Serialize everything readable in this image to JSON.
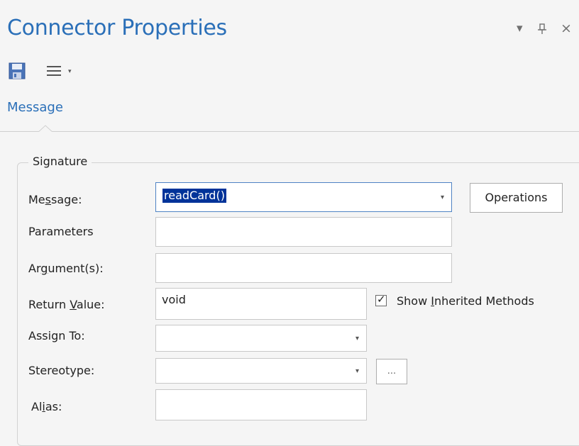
{
  "panel": {
    "title": "Connector Properties",
    "controls": {
      "dropdown_glyph": "▾",
      "pin_glyph": "ꟸ",
      "close_glyph": "×"
    }
  },
  "toolbar": {
    "save_icon": "save-icon",
    "menu_icon": "hamburger-menu-icon",
    "menu_caret": "▾"
  },
  "tab": {
    "label": "Message"
  },
  "signature": {
    "legend": "Signature",
    "message": {
      "label_pre": "Me",
      "label_u": "s",
      "label_post": "sage:",
      "value": "readCard()"
    },
    "operations_button": "Operations",
    "parameters": {
      "label": "Parameters",
      "value": ""
    },
    "arguments": {
      "label_pre": "Ar",
      "label_u": "g",
      "label_post": "ument(s):",
      "value": ""
    },
    "return_value": {
      "label_pre": "Return ",
      "label_u": "V",
      "label_post": "alue:",
      "value": "void"
    },
    "show_inherited": {
      "label_pre": "Show ",
      "label_u": "I",
      "label_post": "nherited Methods",
      "checked": true,
      "mark": "✓"
    },
    "assign_to": {
      "label": "Assign To:",
      "value": ""
    },
    "stereotype": {
      "label": "Stereotype:",
      "value": ""
    },
    "ellipsis_button": "...",
    "alias": {
      "label_pre": "Al",
      "label_u": "i",
      "label_post": "as:",
      "value": ""
    },
    "combo_caret": "▾"
  },
  "colors": {
    "accent": "#2a6fb8",
    "selection": "#003399",
    "background": "#f5f5f5"
  }
}
